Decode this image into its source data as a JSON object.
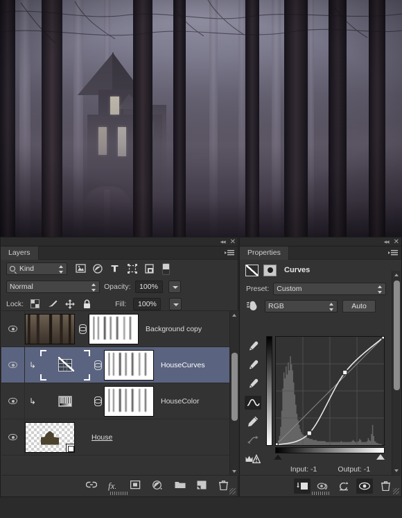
{
  "document": {
    "image_description": "Dark foggy forest with an abandoned wooden house seen between tree trunks"
  },
  "layers_panel": {
    "tab_label": "Layers",
    "topbar": {
      "collapse_icon": "collapse-icon",
      "close_icon": "close-icon"
    },
    "menu_icon": "panel-menu-icon",
    "filter": {
      "kind_label": "Kind",
      "search_icon": "search-icon",
      "buttons": [
        {
          "name": "filter-pixel-layers",
          "icon": "image-icon"
        },
        {
          "name": "filter-adjustment-layers",
          "icon": "adjustment-icon"
        },
        {
          "name": "filter-type-layers",
          "icon": "type-icon"
        },
        {
          "name": "filter-shape-layers",
          "icon": "shape-icon"
        },
        {
          "name": "filter-smart-objects",
          "icon": "smart-object-icon"
        }
      ],
      "toggle_icon": "filter-toggle-switch"
    },
    "blend_mode": "Normal",
    "opacity_label": "Opacity:",
    "opacity_value": "100%",
    "lock_label": "Lock:",
    "lock_icons": [
      {
        "name": "lock-transparent-pixels",
        "icon": "checker-icon"
      },
      {
        "name": "lock-image-pixels",
        "icon": "brush-icon"
      },
      {
        "name": "lock-position",
        "icon": "move-icon"
      },
      {
        "name": "lock-all",
        "icon": "lock-icon"
      }
    ],
    "fill_label": "Fill:",
    "fill_value": "100%",
    "layers": [
      {
        "name": "Background copy",
        "visible": true,
        "selected": false,
        "thumb": "forest-photo",
        "mask": "layer-mask",
        "linked": true,
        "clipped": false,
        "underline": false
      },
      {
        "name": "HouseCurves",
        "visible": true,
        "selected": true,
        "thumb": "curves-adjustment",
        "mask": "white-mask",
        "linked": true,
        "clipped": true,
        "underline": false
      },
      {
        "name": "HouseColor",
        "visible": true,
        "selected": false,
        "thumb": "levels-adjustment",
        "mask": "white-mask",
        "linked": true,
        "clipped": true,
        "underline": false
      },
      {
        "name": "House",
        "visible": true,
        "selected": false,
        "thumb": "transparent-house",
        "mask": null,
        "linked": false,
        "clipped": false,
        "underline": true
      }
    ],
    "footer_buttons": [
      {
        "name": "link-layers-button",
        "icon": "link-icon",
        "label": "⚭"
      },
      {
        "name": "layer-style-button",
        "icon": "fx-icon",
        "label": "fx"
      },
      {
        "name": "add-layer-mask-button",
        "icon": "mask-icon",
        "label": "▣"
      },
      {
        "name": "new-adjustment-layer-button",
        "icon": "adjustment-icon",
        "label": "◐"
      },
      {
        "name": "new-group-button",
        "icon": "folder-icon",
        "label": "▱"
      },
      {
        "name": "new-layer-button",
        "icon": "new-layer-icon",
        "label": "◱"
      },
      {
        "name": "delete-layer-button",
        "icon": "trash-icon",
        "label": "Ὕ1"
      }
    ]
  },
  "properties_panel": {
    "tab_label": "Properties",
    "topbar": {
      "collapse_icon": "collapse-icon",
      "close_icon": "close-icon"
    },
    "menu_icon": "panel-menu-icon",
    "adjustment_title": "Curves",
    "adjustment_icon": "curves-icon",
    "mask_icon": "mask-icon",
    "preset_label": "Preset:",
    "preset_value": "Custom",
    "channel_value": "RGB",
    "auto_label": "Auto",
    "target_adjust_icon": "target-adjustment-icon",
    "tools": [
      {
        "name": "curves-tool-black-point-eyedropper",
        "icon": "eyedropper-icon",
        "active": false
      },
      {
        "name": "curves-tool-gray-point-eyedropper",
        "icon": "eyedropper-icon",
        "active": false
      },
      {
        "name": "curves-tool-white-point-eyedropper",
        "icon": "eyedropper-icon",
        "active": false
      },
      {
        "name": "curves-tool-edit-points",
        "icon": "curve-icon",
        "active": true
      },
      {
        "name": "curves-tool-draw",
        "icon": "pencil-icon",
        "active": false
      },
      {
        "name": "curves-tool-smooth",
        "icon": "smooth-icon",
        "active": false
      },
      {
        "name": "curves-clipping-warning",
        "icon": "clipping-warning-icon",
        "active": false
      }
    ],
    "input_label": "Input:",
    "input_value": "-1",
    "output_label": "Output:",
    "output_value": "-1",
    "footer_buttons": [
      {
        "name": "clip-to-layer-button",
        "icon": "clip-icon",
        "active": true
      },
      {
        "name": "view-previous-state-button",
        "icon": "eye-previous-icon",
        "active": false
      },
      {
        "name": "reset-button",
        "icon": "reset-icon",
        "active": false
      },
      {
        "name": "toggle-visibility-button",
        "icon": "eye-icon",
        "active": true
      },
      {
        "name": "delete-adjustment-button",
        "icon": "trash-icon",
        "active": false
      }
    ]
  },
  "chart_data": {
    "type": "line",
    "title": "Curves",
    "xlabel": "Input",
    "ylabel": "Output",
    "xlim": [
      0,
      255
    ],
    "ylim": [
      0,
      255
    ],
    "grid": true,
    "grid_divisions": 4,
    "series": [
      {
        "name": "RGB curve",
        "points": [
          {
            "input": 0,
            "output": 0
          },
          {
            "input": 79,
            "output": 28
          },
          {
            "input": 163,
            "output": 171
          },
          {
            "input": 255,
            "output": 255
          }
        ]
      },
      {
        "name": "baseline diagonal",
        "points": [
          {
            "input": 0,
            "output": 0
          },
          {
            "input": 255,
            "output": 255
          }
        ]
      }
    ],
    "histogram": [
      2,
      3,
      5,
      9,
      18,
      34,
      56,
      72,
      66,
      78,
      70,
      82,
      74,
      88,
      80,
      74,
      62,
      50,
      40,
      31,
      25,
      20,
      16,
      13,
      11,
      10,
      9,
      8,
      8,
      7,
      7,
      6,
      6,
      6,
      5,
      5,
      5,
      5,
      4,
      4,
      4,
      4,
      4,
      4,
      4,
      4,
      3,
      3,
      3,
      3,
      3,
      3,
      3,
      3,
      3,
      3,
      3,
      3,
      3,
      3,
      4,
      3,
      3,
      3,
      3,
      3,
      3,
      3,
      3,
      3,
      4,
      5,
      4,
      3,
      3,
      3,
      4,
      6,
      5,
      3,
      3,
      3,
      3,
      3,
      4,
      7,
      5,
      4,
      11,
      20,
      9,
      4,
      3,
      2,
      2,
      1,
      1,
      1,
      0,
      0
    ],
    "black_point": 0,
    "white_point": 255,
    "colors": {
      "curve": "#e8e8e8",
      "baseline": "#8a8a8a",
      "histogram": "#8e8e8e",
      "background": "#333333"
    }
  }
}
